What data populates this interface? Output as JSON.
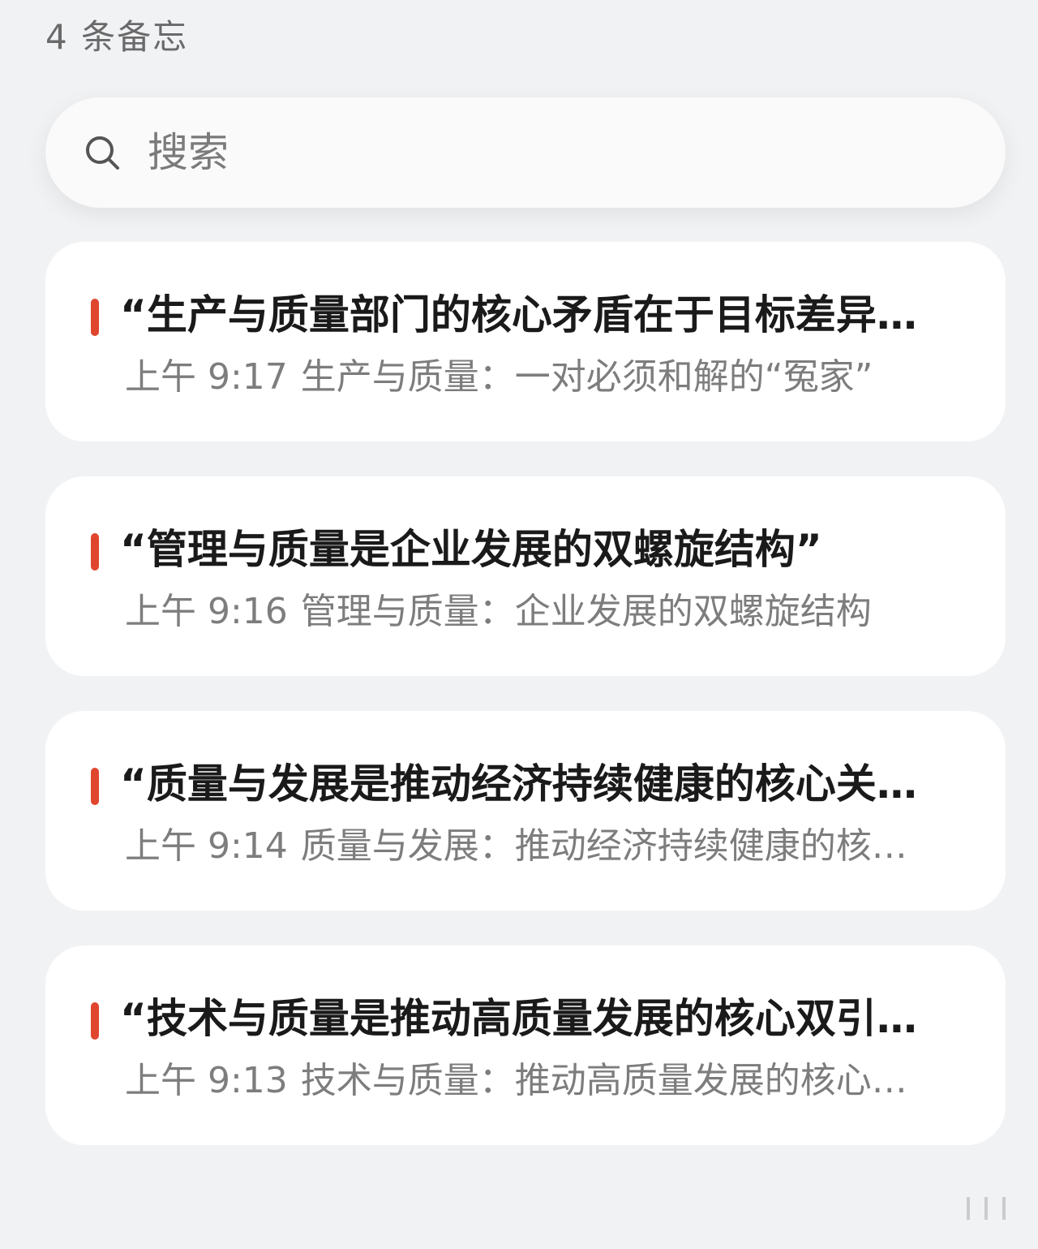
{
  "header": {
    "count_label": "4 条备忘"
  },
  "search": {
    "placeholder": "搜索"
  },
  "notes": [
    {
      "title": "“生产与质量部门的核心矛盾在于目标差异…",
      "time": "上午 9:17",
      "preview": "生产与质量：一对必须和解的“冤家”"
    },
    {
      "title": "“管理与质量是企业发展的双螺旋结构”",
      "time": "上午 9:16",
      "preview": "管理与质量：企业发展的双螺旋结构"
    },
    {
      "title": "“质量与发展是推动经济持续健康的核心关…",
      "time": "上午 9:14",
      "preview": "质量与发展：推动经济持续健康的核…"
    },
    {
      "title": "“技术与质量是推动高质量发展的核心双引…",
      "time": "上午 9:13",
      "preview": "技术与质量：推动高质量发展的核心…"
    }
  ],
  "colors": {
    "background": "#f1f2f4",
    "card": "#ffffff",
    "accent_marker": "#e0462e",
    "title_text": "#1a1a1a",
    "secondary_text": "#7d7d7d"
  },
  "icons": {
    "search": "search-icon",
    "note_marker": "red-bar-marker"
  }
}
